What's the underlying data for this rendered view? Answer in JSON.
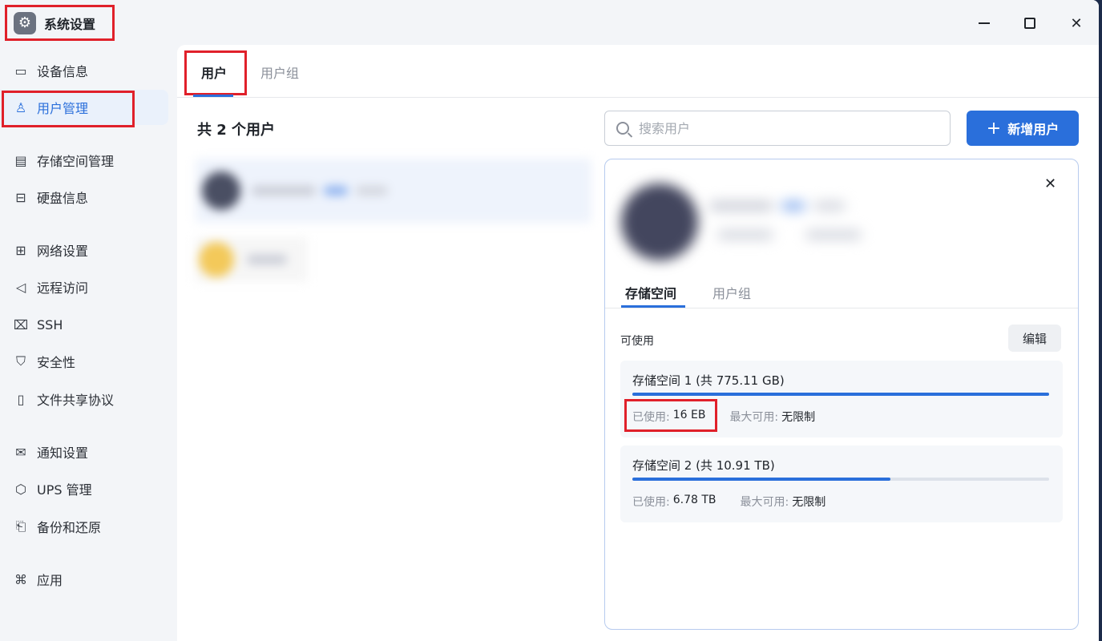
{
  "window": {
    "title": "系统设置",
    "app_icon": "gear-icon"
  },
  "sidebar": {
    "items": [
      {
        "label": "设备信息",
        "icon": "monitor-icon",
        "glyph": "▭"
      },
      {
        "label": "用户管理",
        "icon": "user-icon",
        "glyph": "♙",
        "active": true
      },
      {
        "label": "存储空间管理",
        "icon": "storage-icon",
        "glyph": "▤"
      },
      {
        "label": "硬盘信息",
        "icon": "disk-icon",
        "glyph": "⊟"
      },
      {
        "label": "网络设置",
        "icon": "network-icon",
        "glyph": "⊞"
      },
      {
        "label": "远程访问",
        "icon": "send-icon",
        "glyph": "◁"
      },
      {
        "label": "SSH",
        "icon": "terminal-icon",
        "glyph": "⌧"
      },
      {
        "label": "安全性",
        "icon": "shield-icon",
        "glyph": "⛉"
      },
      {
        "label": "文件共享协议",
        "icon": "file-icon",
        "glyph": "▯"
      },
      {
        "label": "通知设置",
        "icon": "mail-icon",
        "glyph": "✉"
      },
      {
        "label": "UPS 管理",
        "icon": "ups-icon",
        "glyph": "⬡"
      },
      {
        "label": "备份和还原",
        "icon": "backup-icon",
        "glyph": "⎗"
      },
      {
        "label": "应用",
        "icon": "apps-icon",
        "glyph": "⌘"
      }
    ]
  },
  "main": {
    "tabs": [
      {
        "label": "用户"
      },
      {
        "label": "用户组"
      }
    ],
    "count_label": "共 2 个用户",
    "search": {
      "placeholder": "搜索用户",
      "value": ""
    },
    "add_button": "新增用户"
  },
  "detail": {
    "tabs": [
      {
        "label": "存储空间"
      },
      {
        "label": "用户组"
      }
    ],
    "available_label": "可使用",
    "edit_button": "编辑",
    "pools": [
      {
        "title": "存储空间 1 (共 775.11 GB)",
        "used_label": "已使用:",
        "used_value": "16 EB",
        "max_label": "最大可用:",
        "max_value": "无限制",
        "usage_fraction": 1.0
      },
      {
        "title": "存储空间 2 (共 10.91 TB)",
        "used_label": "已使用:",
        "used_value": "6.78 TB",
        "max_label": "最大可用:",
        "max_value": "无限制",
        "usage_fraction": 0.62
      }
    ]
  },
  "colors": {
    "accent": "#2a6fdb",
    "highlight_frame": "#e0202a"
  }
}
